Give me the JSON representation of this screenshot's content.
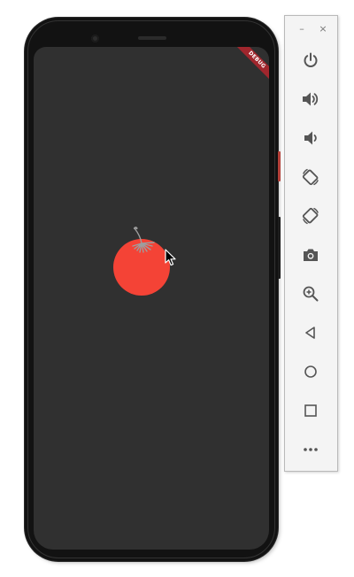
{
  "emulator": {
    "debug_banner_text": "DEBUG",
    "window_controls": {
      "minimize_glyph": "–",
      "close_glyph": "×"
    },
    "toolbar_buttons": [
      {
        "icon": "power-icon"
      },
      {
        "icon": "volume-up-icon"
      },
      {
        "icon": "volume-down-icon"
      },
      {
        "icon": "rotate-left-icon"
      },
      {
        "icon": "rotate-right-icon"
      },
      {
        "icon": "camera-icon"
      },
      {
        "icon": "zoom-in-icon"
      },
      {
        "icon": "back-icon"
      },
      {
        "icon": "home-icon"
      },
      {
        "icon": "overview-icon"
      },
      {
        "icon": "more-icon"
      }
    ]
  },
  "app": {
    "background_color": "#303030",
    "tomato_color": "#f44336",
    "stem_color": "#9e9e9e"
  },
  "colors": {
    "debug_ribbon": "#a0262d",
    "icon": "#555555"
  }
}
